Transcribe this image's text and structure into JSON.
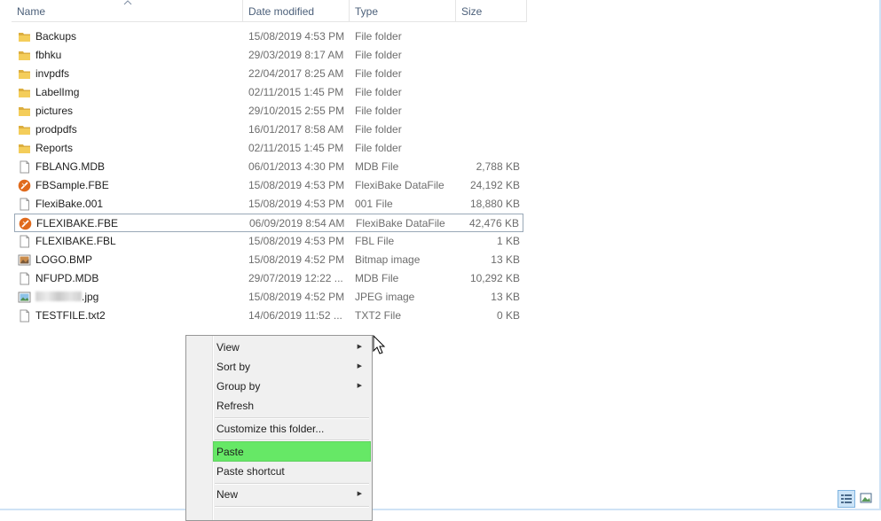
{
  "columns": {
    "name": "Name",
    "date": "Date modified",
    "type": "Type",
    "size": "Size"
  },
  "files": [
    {
      "name": "Backups",
      "date": "15/08/2019 4:53 PM",
      "type": "File folder",
      "size": "",
      "icon": "folder-icon"
    },
    {
      "name": "fbhku",
      "date": "29/03/2019 8:17 AM",
      "type": "File folder",
      "size": "",
      "icon": "folder-icon"
    },
    {
      "name": "invpdfs",
      "date": "22/04/2017 8:25 AM",
      "type": "File folder",
      "size": "",
      "icon": "folder-icon"
    },
    {
      "name": "LabelImg",
      "date": "02/11/2015 1:45 PM",
      "type": "File folder",
      "size": "",
      "icon": "folder-icon"
    },
    {
      "name": "pictures",
      "date": "29/10/2015 2:55 PM",
      "type": "File folder",
      "size": "",
      "icon": "folder-icon"
    },
    {
      "name": "prodpdfs",
      "date": "16/01/2017 8:58 AM",
      "type": "File folder",
      "size": "",
      "icon": "folder-icon"
    },
    {
      "name": "Reports",
      "date": "02/11/2015 1:45 PM",
      "type": "File folder",
      "size": "",
      "icon": "folder-icon"
    },
    {
      "name": "FBLANG.MDB",
      "date": "06/01/2013 4:30 PM",
      "type": "MDB File",
      "size": "2,788 KB",
      "icon": "file-icon"
    },
    {
      "name": "FBSample.FBE",
      "date": "15/08/2019 4:53 PM",
      "type": "FlexiBake DataFile",
      "size": "24,192 KB",
      "icon": "flexibake-icon"
    },
    {
      "name": "FlexiBake.001",
      "date": "15/08/2019 4:53 PM",
      "type": "001 File",
      "size": "18,880 KB",
      "icon": "file-icon"
    },
    {
      "name": "FLEXIBAKE.FBE",
      "date": "06/09/2019 8:54 AM",
      "type": "FlexiBake DataFile",
      "size": "42,476 KB",
      "icon": "flexibake-icon",
      "selected": true
    },
    {
      "name": "FLEXIBAKE.FBL",
      "date": "15/08/2019 4:53 PM",
      "type": "FBL File",
      "size": "1 KB",
      "icon": "file-icon"
    },
    {
      "name": "LOGO.BMP",
      "date": "15/08/2019 4:52 PM",
      "type": "Bitmap image",
      "size": "13 KB",
      "icon": "bitmap-icon"
    },
    {
      "name": "NFUPD.MDB",
      "date": "29/07/2019 12:22 ...",
      "type": "MDB File",
      "size": "10,292 KB",
      "icon": "file-icon"
    },
    {
      "name": ".jpg",
      "date": "15/08/2019 4:52 PM",
      "type": "JPEG image",
      "size": "13 KB",
      "icon": "jpeg-icon",
      "redacted": true
    },
    {
      "name": "TESTFILE.txt2",
      "date": "14/06/2019 11:52 ...",
      "type": "TXT2 File",
      "size": "0 KB",
      "icon": "file-icon"
    }
  ],
  "context_menu": {
    "view": "View",
    "sort_by": "Sort by",
    "group_by": "Group by",
    "refresh": "Refresh",
    "customize": "Customize this folder...",
    "paste": "Paste",
    "paste_shortcut": "Paste shortcut",
    "new": "New"
  },
  "colors": {
    "highlight": "#66e866",
    "folder": "#e8b64a",
    "flexibake": "#e06a1c",
    "header_text": "#4c607a"
  }
}
